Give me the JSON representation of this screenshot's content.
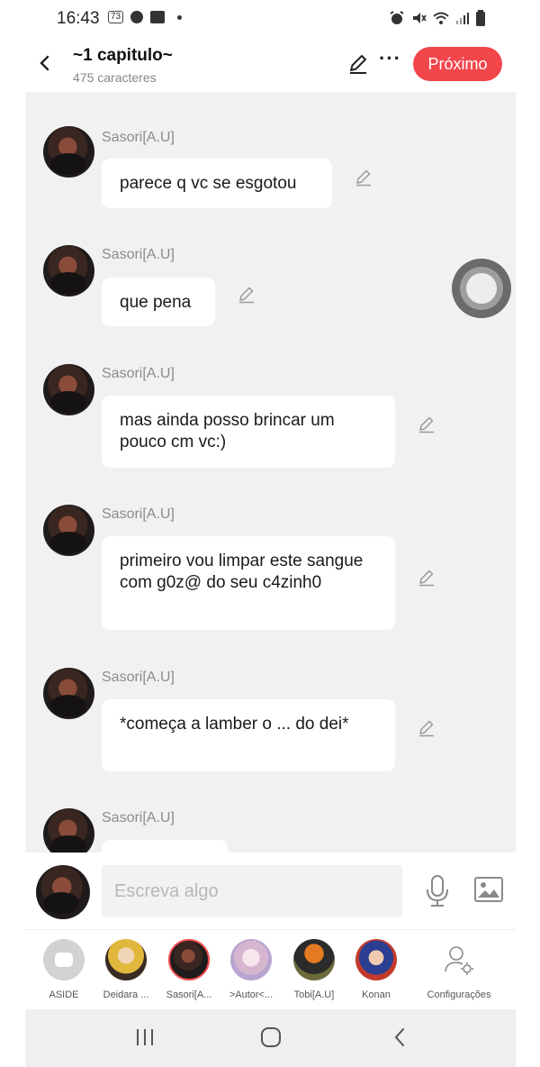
{
  "status_bar": {
    "time": "16:43",
    "badge": "73",
    "icons": [
      "notification-count-icon",
      "record-icon",
      "gallery-icon",
      "alarm-icon",
      "mute-icon",
      "wifi-icon",
      "signal-icon",
      "battery-icon"
    ]
  },
  "header": {
    "title": "~1 capitulo~",
    "subtitle": "475 caracteres",
    "next_label": "Próximo",
    "accent_color": "#f2464b"
  },
  "messages": [
    {
      "sender": "Sasori[A.U]",
      "text": "parece q vc se esgotou"
    },
    {
      "sender": "Sasori[A.U]",
      "text": "que pena"
    },
    {
      "sender": "Sasori[A.U]",
      "text": "mas ainda posso brincar um pouco cm vc:)"
    },
    {
      "sender": "Sasori[A.U]",
      "text": "primeiro vou limpar este sangue com g0z@ do seu c4zinh0"
    },
    {
      "sender": "Sasori[A.U]",
      "text": "*começa  a lamber o ... do dei*"
    },
    {
      "sender": "Sasori[A.U]",
      "text": ""
    }
  ],
  "composer": {
    "placeholder": "Escreva algo"
  },
  "characters": [
    {
      "label": "ASIDE"
    },
    {
      "label": "Deidara ..."
    },
    {
      "label": "Sasori[A..."
    },
    {
      "label": ">Autor<..."
    },
    {
      "label": "Tobi[A.U]"
    },
    {
      "label": "Konan"
    },
    {
      "label": "Configurações"
    }
  ]
}
